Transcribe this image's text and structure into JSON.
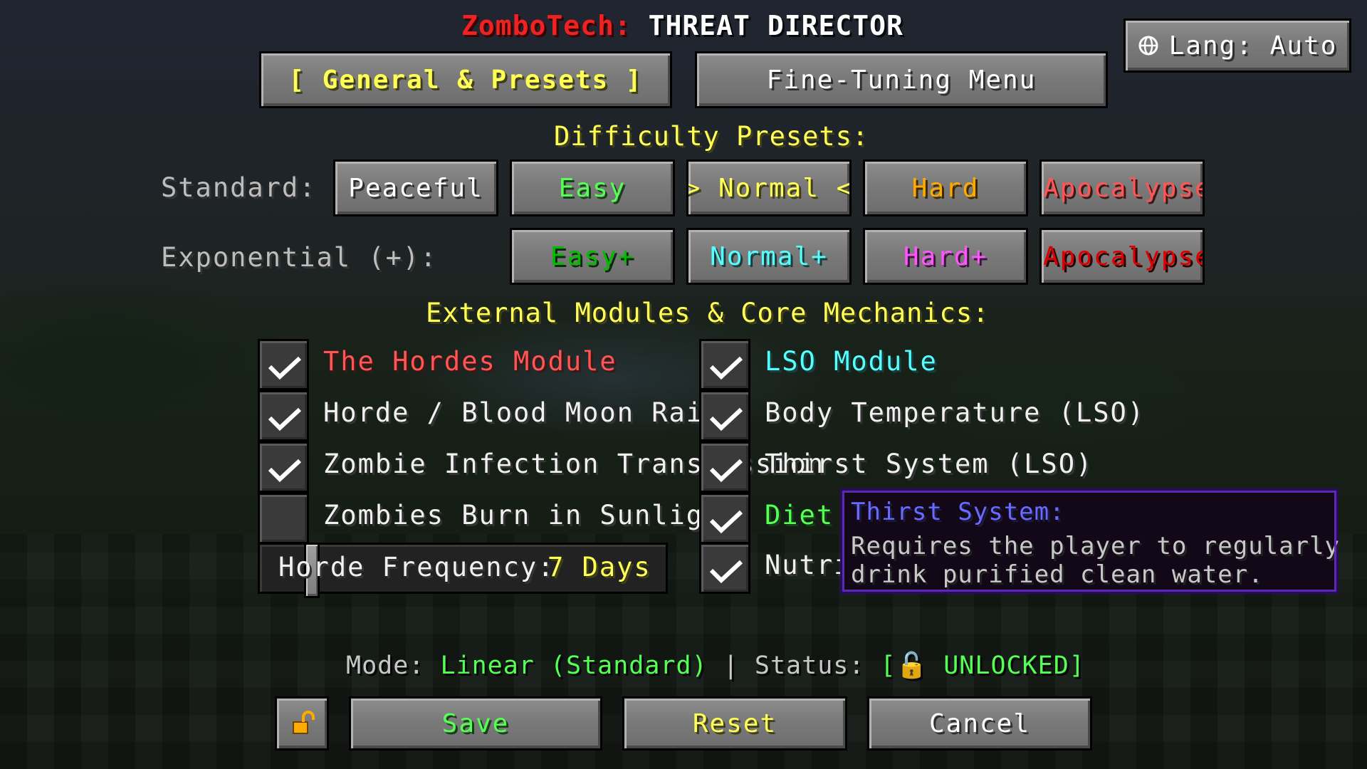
{
  "colors": {
    "accent_yellow": "#ffff55",
    "title_red": "#ff3333",
    "green": "#55ff55",
    "aqua": "#55ffff",
    "gold": "#ffaa00",
    "pink": "#ff55ff",
    "red": "#ff5555",
    "dark_red": "#ee1111",
    "dark_green": "#00cc00",
    "tooltip_title": "#6666ff"
  },
  "header": {
    "brand": "ZomboTech:",
    "title": "THREAT DIRECTOR"
  },
  "lang_button": {
    "icon": "globe-icon",
    "label": "Lang: Auto"
  },
  "tabs": [
    {
      "label": "[ General & Presets ]",
      "active": true
    },
    {
      "label": "Fine-Tuning Menu",
      "active": false
    }
  ],
  "presets": {
    "heading": "Difficulty Presets:",
    "standard_label": "Standard:",
    "standard": [
      "Peaceful",
      "Easy",
      "> Normal <",
      "Hard",
      "Apocalypse"
    ],
    "exponential_label": "Exponential (+):",
    "exponential": [
      "Easy+",
      "Normal+",
      "Hard+",
      "Apocalypse"
    ]
  },
  "modules": {
    "heading": "External Modules & Core Mechanics:",
    "left": [
      {
        "label": "The Hordes Module",
        "checked": true
      },
      {
        "label": "Horde / Blood Moon Raids",
        "checked": true
      },
      {
        "label": "Zombie Infection Transmission",
        "checked": true
      },
      {
        "label": "Zombies Burn in Sunlight",
        "checked": false
      }
    ],
    "right": [
      {
        "label": "LSO Module",
        "checked": true
      },
      {
        "label": "Body Temperature (LSO)",
        "checked": true
      },
      {
        "label": "Thirst System (LSO)",
        "checked": true
      },
      {
        "label": "Diet M",
        "checked": true
      },
      {
        "label": "Nutrit",
        "checked": true
      }
    ]
  },
  "horde_frequency": {
    "label": "Horde Frequency:",
    "value": "7 Days"
  },
  "tooltip": {
    "title": "Thirst System:",
    "line1": "Requires the player to regularly",
    "line2": "drink purified clean water."
  },
  "status_bar": {
    "mode_label": "Mode:",
    "mode_value": "Linear (Standard)",
    "separator": "|",
    "status_label": "Status:",
    "status_value": "[🔓 UNLOCKED]"
  },
  "footer": {
    "lock_icon": "unlock-icon",
    "save": "Save",
    "reset": "Reset",
    "cancel": "Cancel"
  }
}
